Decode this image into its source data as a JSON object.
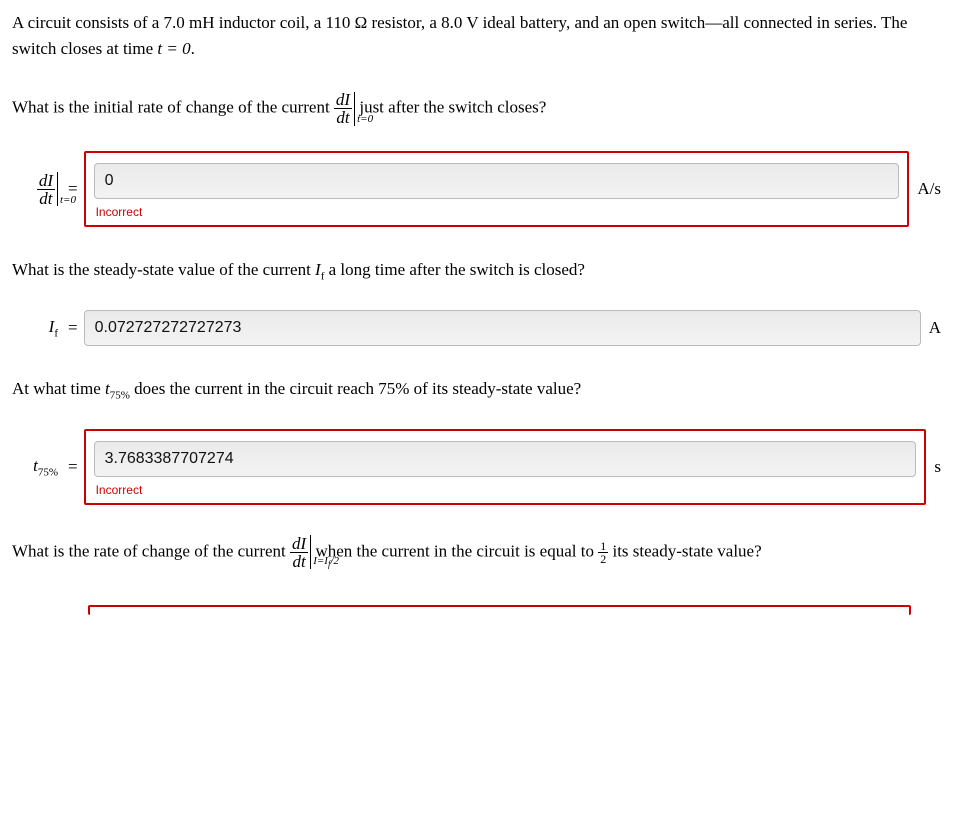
{
  "problem": {
    "intro": "A circuit consists of a 7.0 mH inductor coil, a 110 Ω resistor, a 8.0 V ideal battery, and an open switch—all connected in series. The switch closes at time ",
    "intro_math": "t = 0",
    "intro_end": "."
  },
  "q1": {
    "text_before": "What is the initial rate of change of the current ",
    "text_after": " just after the switch closes?",
    "label_sub": "t=0",
    "value": "0",
    "unit": "A/s",
    "feedback": "Incorrect"
  },
  "q2": {
    "text_before": "What is the steady-state value of the current ",
    "text_after": " a long time after the switch is closed?",
    "label_sym": "I",
    "label_sub": "f",
    "value": "0.072727272727273",
    "unit": "A"
  },
  "q3": {
    "text_before": "At what time ",
    "text_after": " does the current in the circuit reach 75% of its steady-state value?",
    "label_sym": "t",
    "label_sub": "75%",
    "value": "3.7683387707274",
    "unit": "s",
    "feedback": "Incorrect"
  },
  "q4": {
    "text_before": "What is the rate of change of the current ",
    "text_after_1": " when the current in the circuit is equal to ",
    "text_after_2": " its steady-state value?",
    "eval_sub": "I=I",
    "eval_sub2": "f",
    "eval_sub3": "/2"
  }
}
